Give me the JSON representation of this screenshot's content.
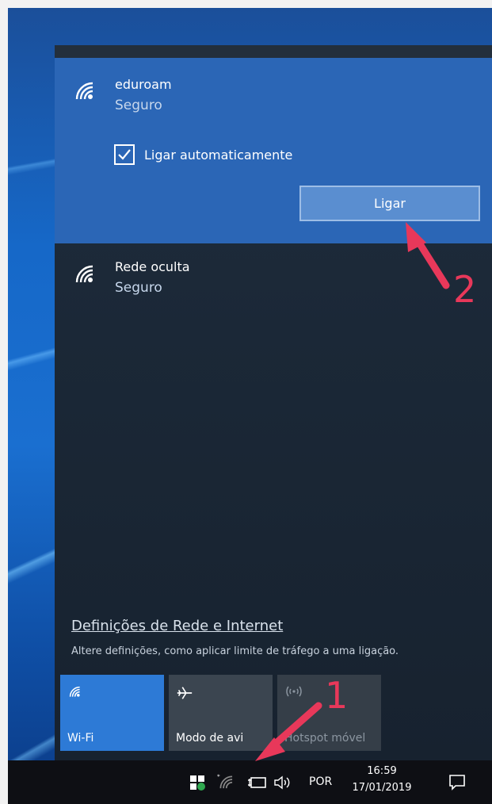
{
  "selected_network": {
    "name": "eduroam",
    "status": "Seguro",
    "auto_connect_label": "Ligar automaticamente",
    "auto_connect_checked": true,
    "connect_button": "Ligar"
  },
  "other_networks": [
    {
      "name": "Rede oculta",
      "status": "Seguro"
    }
  ],
  "settings": {
    "link": "Definições de Rede e Internet",
    "description": "Altere definições, como aplicar limite de tráfego a uma ligação."
  },
  "quick_actions": [
    {
      "label": "Wi-Fi",
      "active": true,
      "icon": "wifi-icon"
    },
    {
      "label": "Modo de avi",
      "active": false,
      "icon": "airplane-icon"
    },
    {
      "label": "Hotspot móvel",
      "active": false,
      "icon": "hotspot-icon"
    }
  ],
  "taskbar": {
    "language": "POR",
    "time": "16:59",
    "date": "17/01/2019"
  },
  "annotations": [
    {
      "label": "1"
    },
    {
      "label": "2"
    }
  ],
  "colors": {
    "accent": "#2b66b6",
    "panel": "#1b2837",
    "annotation": "#e8385a"
  }
}
